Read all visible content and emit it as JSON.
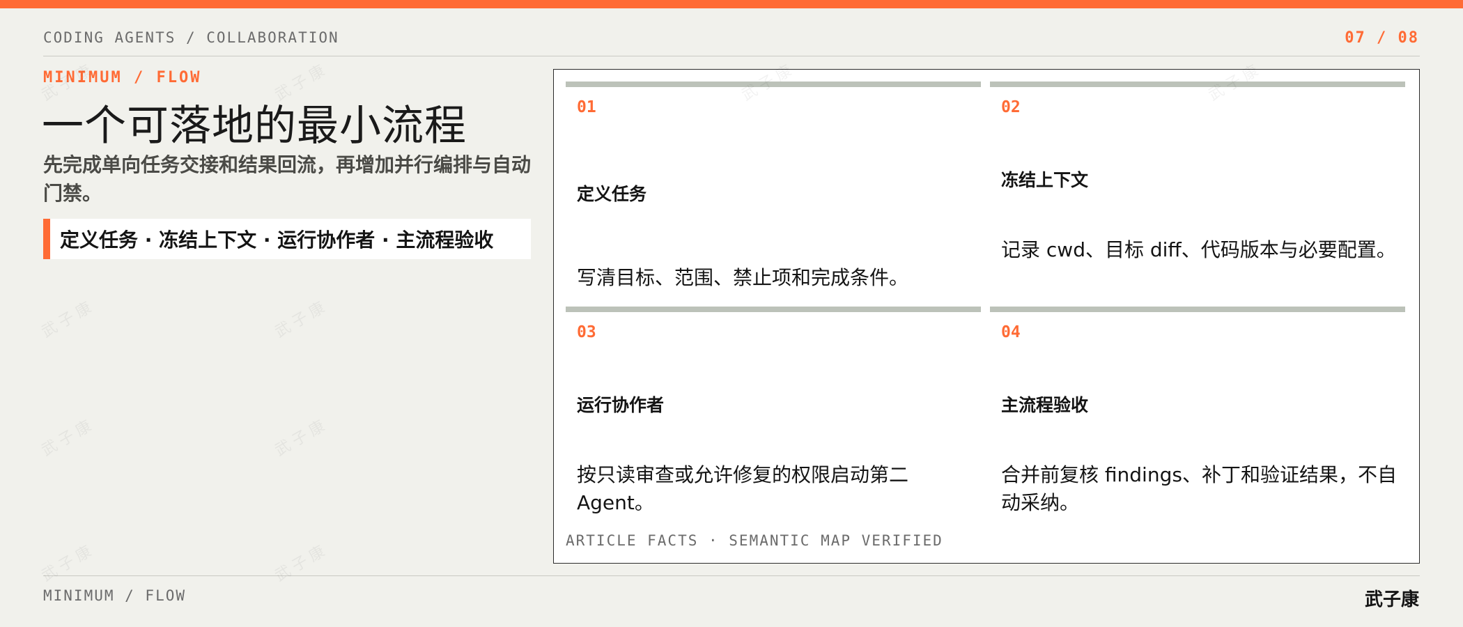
{
  "colors": {
    "accent": "#ff6b35",
    "background": "#f1f1ec",
    "step_bar": "#bcc2b9",
    "muted_text": "#6b6b6b"
  },
  "header": {
    "section": "CODING AGENTS / COLLABORATION",
    "page": "07 / 08"
  },
  "kicker": "MINIMUM / FLOW",
  "title": "一个可落地的最小流程",
  "subtitle": "先完成单向任务交接和结果回流，再增加并行编排与自动门禁。",
  "summary": "定义任务 · 冻结上下文 · 运行协作者 · 主流程验收",
  "steps": [
    {
      "number": "01",
      "title": "定义任务",
      "description": "写清目标、范围、禁止项和完成条件。"
    },
    {
      "number": "02",
      "title": "冻结上下文",
      "description": "记录 cwd、目标 diff、代码版本与必要配置。"
    },
    {
      "number": "03",
      "title": "运行协作者",
      "description": "按只读审查或允许修复的权限启动第二 Agent。"
    },
    {
      "number": "04",
      "title": "主流程验收",
      "description": "合并前复核 findings、补丁和验证结果，不自动采纳。"
    }
  ],
  "card_footer": "ARTICLE FACTS · SEMANTIC MAP VERIFIED",
  "footer": {
    "section": "MINIMUM / FLOW",
    "author": "武子康"
  },
  "watermark": "武子康"
}
